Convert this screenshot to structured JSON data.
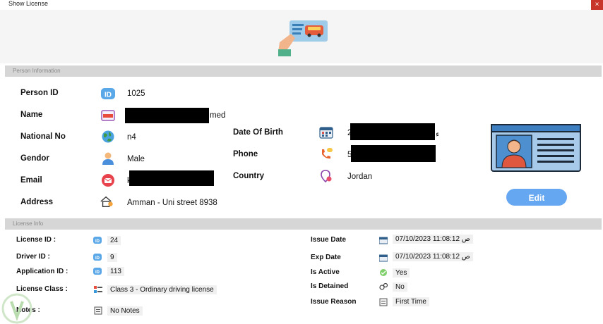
{
  "window": {
    "title": "Show License",
    "close_glyph": "×"
  },
  "person": {
    "section_title": "Person Information",
    "person_id_label": "Person ID",
    "person_id": "1025",
    "name_label": "Name",
    "name_suffix": "med",
    "national_no_label": "National No",
    "national_no": "n4",
    "gender_label": "Gendor",
    "gender": "Male",
    "email_label": "Email",
    "email_prefix": "k",
    "address_label": "Address",
    "address": "Amman - Uni street 8938",
    "dob_label": "Date Of Birth",
    "dob_prefix": "2",
    "dob_suffix": "ء",
    "phone_label": "Phone",
    "phone_prefix": "5",
    "country_label": "Country",
    "country": "Jordan",
    "edit_label": "Edit"
  },
  "license": {
    "section_title": "License Info",
    "license_id_label": "License ID :",
    "license_id": "24",
    "driver_id_label": "Driver ID :",
    "driver_id": "9",
    "application_id_label": "Application ID :",
    "application_id": "113",
    "license_class_label": "License Class :",
    "license_class": "Class 3 - Ordinary driving license",
    "notes_label": "Notes :",
    "notes": "No Notes",
    "issue_date_label": "Issue Date",
    "issue_date": "07/10/2023 11:08:12 ص",
    "exp_date_label": "Exp Date",
    "exp_date": "07/10/2023 11:08:12 ص",
    "is_active_label": "Is Active",
    "is_active": "Yes",
    "is_detained_label": "Is Detained",
    "is_detained": "No",
    "issue_reason_label": "Issue Reason",
    "issue_reason": "First Time"
  },
  "colors": {
    "accent": "#66a7f2",
    "close": "#c8352b",
    "header": "#d6d6d6"
  }
}
